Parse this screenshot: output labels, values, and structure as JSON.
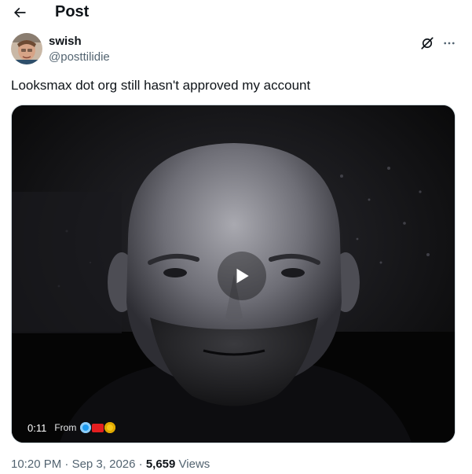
{
  "header": {
    "title": "Post"
  },
  "tweet": {
    "author": {
      "display_name": "swish",
      "handle": "@posttilidie"
    },
    "text": "Looksmax dot org still hasn't approved my account",
    "media": {
      "duration": "0:11",
      "from_label": "From",
      "from_icons": [
        "globe-icon",
        "flag-icon",
        "hazard-icon"
      ]
    },
    "time": "10:20 PM",
    "date": "Sep 3, 2026",
    "separator": "·",
    "views_count": "5,659",
    "views_label": "Views"
  },
  "icons": {
    "back": "arrow-left-icon",
    "grok": "grok-icon",
    "more": "more-icon",
    "play": "play-icon"
  },
  "colors": {
    "text_primary": "#0f1419",
    "text_secondary": "#536471",
    "border": "#cfd9de"
  }
}
